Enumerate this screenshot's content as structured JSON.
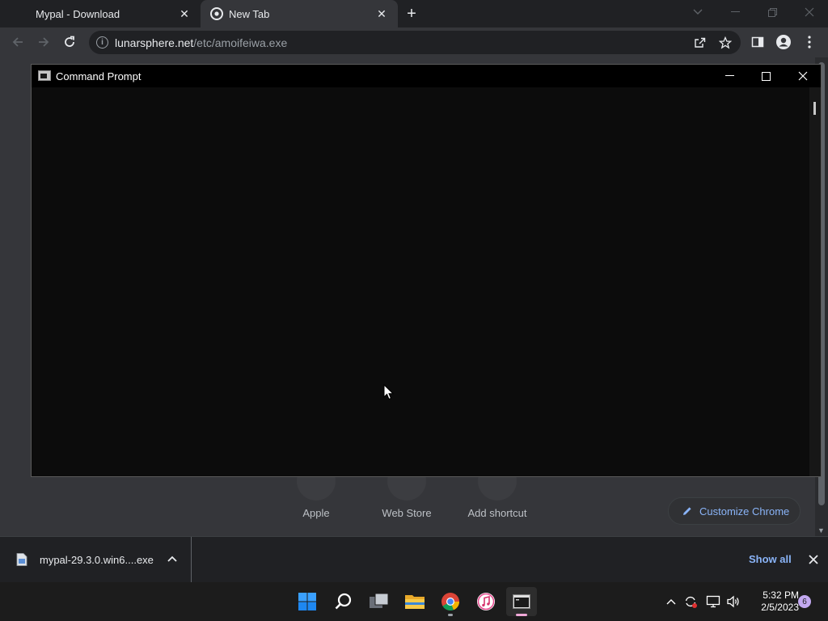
{
  "browser": {
    "tabs": [
      {
        "title": "Mypal - Download",
        "active": false
      },
      {
        "title": "New Tab",
        "active": true
      }
    ],
    "address": {
      "host": "lunarsphere.net",
      "path": "/etc/amoifeiwa.exe"
    }
  },
  "new_tab_page": {
    "shortcuts": [
      {
        "label": "Apple"
      },
      {
        "label": "Web Store"
      },
      {
        "label": "Add shortcut"
      }
    ],
    "customize_label": "Customize Chrome"
  },
  "cmd_window": {
    "title": "Command Prompt"
  },
  "download_bar": {
    "file_name": "mypal-29.3.0.win6....exe",
    "show_all_label": "Show all"
  },
  "taskbar": {
    "apps": [
      "start-icon",
      "search-icon",
      "task-view-icon",
      "file-explorer-icon",
      "chrome-icon",
      "itunes-icon",
      "command-prompt-icon"
    ],
    "time": "5:32 PM",
    "date": "2/5/2023",
    "notification_count": "6"
  },
  "colors": {
    "chrome_frame": "#202124",
    "chrome_toolbar": "#35363a",
    "link_accent": "#8ab4f8",
    "console_bg": "#0c0c0c",
    "taskbar_bg": "#1c1c1c"
  }
}
